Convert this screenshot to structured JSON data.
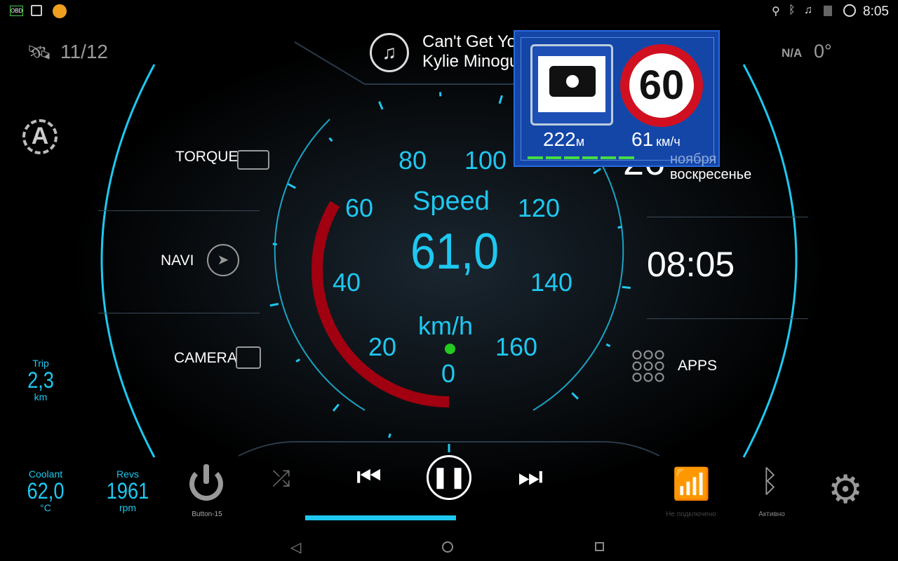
{
  "status_bar": {
    "time": "8:05",
    "left_icons": [
      "obd-icon",
      "speed-camera-icon",
      "clock-alert-icon"
    ],
    "right_icons": [
      "location-icon",
      "bluetooth-icon",
      "headphones-icon",
      "no-sim-icon",
      "alarm-icon"
    ]
  },
  "gps": {
    "satellites": "11/12"
  },
  "weather": {
    "condition": "N/A",
    "temperature": "0°"
  },
  "media": {
    "title": "Can't Get You",
    "artist": "Kylie Minogue",
    "progress": 0.33
  },
  "menu": {
    "torque": "TORQUE",
    "navi": "NAVI",
    "camera": "CAMERA",
    "apps": "APPS"
  },
  "auto_brightness": "A",
  "speedometer": {
    "label": "Speed",
    "value": "61,0",
    "unit": "km/h",
    "ticks": [
      "0",
      "20",
      "40",
      "60",
      "80",
      "100",
      "120",
      "140",
      "160"
    ],
    "max": 160,
    "arc_value": 61,
    "accent": "#1ec8f0",
    "arc_color": "#a00010"
  },
  "date": {
    "day": "26",
    "month": "ноября",
    "weekday": "воскресенье"
  },
  "clock": "08:05",
  "stats": {
    "trip": {
      "label": "Trip",
      "value": "2,3",
      "unit": "km"
    },
    "coolant": {
      "label": "Coolant",
      "value": "62,0",
      "unit": "°C"
    },
    "revs": {
      "label": "Revs",
      "value": "1961",
      "unit": "rpm"
    }
  },
  "power_button": "Button-15",
  "wifi": {
    "status": "Не подключено"
  },
  "bluetooth": {
    "status": "Активно"
  },
  "camera_alert": {
    "distance": "222",
    "distance_unit": "м",
    "speed_limit": "60",
    "speed": "61",
    "speed_unit": "км/ч"
  }
}
